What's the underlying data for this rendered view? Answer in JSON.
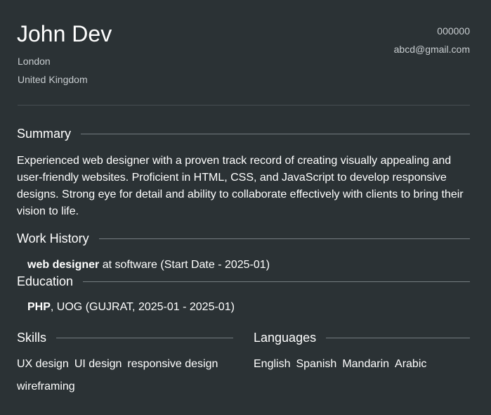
{
  "header": {
    "name": "John Dev",
    "city": "London",
    "country": "United Kingdom",
    "phone": "000000",
    "email": "abcd@gmail.com"
  },
  "summary": {
    "title": "Summary",
    "text": "Experienced web designer with a proven track record of creating visually appealing and user-friendly websites. Proficient in HTML, CSS, and JavaScript to develop responsive designs. Strong eye for detail and ability to collaborate effectively with clients to bring their vision to life."
  },
  "work_history": {
    "title": "Work History",
    "items": [
      {
        "role": "web designer",
        "details": " at software (Start Date - 2025-01)"
      }
    ]
  },
  "education": {
    "title": "Education",
    "items": [
      {
        "degree": "PHP",
        "details": ", UOG (GUJRAT, 2025-01 - 2025-01)"
      }
    ]
  },
  "skills": {
    "title": "Skills",
    "items": [
      "UX design",
      "UI design",
      "responsive design",
      "wireframing"
    ]
  },
  "languages": {
    "title": "Languages",
    "items": [
      "English",
      "Spanish",
      "Mandarin",
      "Arabic"
    ]
  },
  "colors": {
    "background": "#2b3235",
    "text": "#ffffff",
    "muted": "#c8cdd0",
    "rule": "#757d81"
  }
}
